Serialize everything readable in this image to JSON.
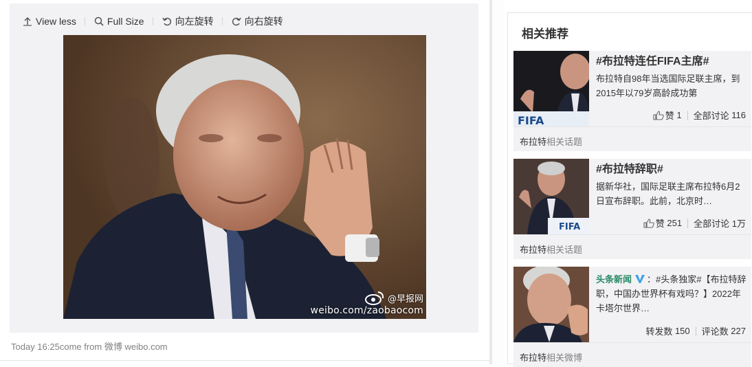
{
  "toolbar": {
    "view_less": "View less",
    "full_size": "Full Size",
    "rotate_left": "向左旋转",
    "rotate_right": "向右旋转"
  },
  "photo": {
    "watermark_brand": "@早报网",
    "watermark_url": "weibo.com/zaobaocom"
  },
  "post_meta": {
    "time": "Today 16:25",
    "come_from": "come from",
    "source": "微博 weibo.com"
  },
  "related": {
    "header": "相关推荐",
    "cards": [
      {
        "title": "#布拉特连任FIFA主席#",
        "desc": "布拉特自98年当选国际足联主席，到2015年以79岁高龄成功第",
        "likes_label": "赞",
        "likes": "1",
        "discuss_label": "全部讨论",
        "discuss": "116",
        "foot_name": "布拉特",
        "foot_tag": "相关话题",
        "thumb_text": "FIFA"
      },
      {
        "title": "#布拉特辞职#",
        "desc": "据新华社，国际足联主席布拉特6月2日宣布辞职。此前，北京时…",
        "likes_label": "赞",
        "likes": "251",
        "discuss_label": "全部讨论",
        "discuss": "1万",
        "foot_name": "布拉特",
        "foot_tag": "相关话题",
        "thumb_text": "FIFA"
      },
      {
        "author": "头条新闻",
        "desc": "：#头条独家#【布拉特辞职，中国办世界杯有戏吗？】2022年卡塔尔世界…",
        "repost_label": "转发数",
        "repost": "150",
        "comment_label": "评论数",
        "comment": "227",
        "foot_name": "布拉特",
        "foot_tag": "相关微博"
      }
    ]
  },
  "colors": {
    "panel_bg": "#f2f2f5",
    "author_green": "#2a8a66",
    "verified_blue": "#3aa0e8",
    "muted": "#808080"
  }
}
